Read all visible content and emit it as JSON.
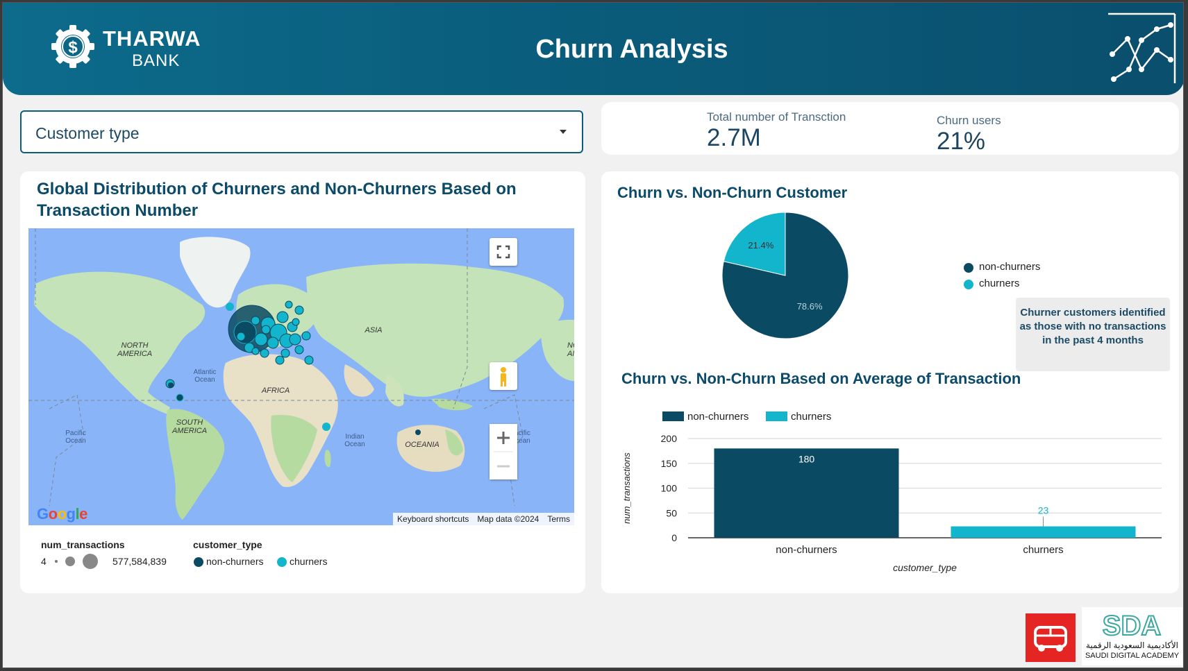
{
  "header": {
    "brand": "THARWA",
    "brand_sub": "BANK",
    "title": "Churn Analysis"
  },
  "filter": {
    "label": "Customer type"
  },
  "kpis": {
    "transactions_label": "Total number of Transction",
    "transactions_value": "2.7M",
    "churn_label": "Churn users",
    "churn_value": "21%"
  },
  "map_card": {
    "title": "Global Distribution of Churners and Non-Churners Based on Transaction Number",
    "labels": {
      "north_america": [
        "NORTH",
        "AMERICA"
      ],
      "south_america": [
        "SOUTH",
        "AMERICA"
      ],
      "africa": "AFRICA",
      "asia": "ASIA",
      "oceania": "OCEANIA",
      "atlantic": [
        "Atlantic",
        "Ocean"
      ],
      "pacific": [
        "Pacific",
        "Ocean"
      ],
      "pacific_right": [
        "Pacific",
        "Ocean"
      ],
      "indian": [
        "Indian",
        "Ocean"
      ],
      "na_right": [
        "NO",
        "AM"
      ]
    },
    "attribution": {
      "shortcuts": "Keyboard shortcuts",
      "map_data": "Map data ©2024",
      "terms": "Terms"
    },
    "google": "Google",
    "legend": {
      "size_title": "num_transactions",
      "size_min": "4",
      "size_max": "577,584,839",
      "color_title": "customer_type",
      "color_items": [
        "non-churners",
        "churners"
      ]
    }
  },
  "colors": {
    "non_churners": "#0b4a63",
    "churners": "#12b5cb",
    "title": "#0b4a69"
  },
  "chart_data": [
    {
      "type": "pie",
      "title": "Churn vs. Non-Churn Customer",
      "categories": [
        "non-churners",
        "churners"
      ],
      "values": [
        78.6,
        21.4
      ],
      "labels": [
        "78.6%",
        "21.4%"
      ],
      "legend": "right"
    },
    {
      "type": "bar",
      "title": "Churn vs. Non-Churn Based on Average of Transaction",
      "categories": [
        "non-churners",
        "churners"
      ],
      "values": [
        180,
        23
      ],
      "xlabel": "customer_type",
      "ylabel": "num_transactions",
      "ylim": [
        0,
        200
      ],
      "yticks": [
        0,
        50,
        100,
        150,
        200
      ],
      "grid": true,
      "legend": "top-left"
    }
  ],
  "note": "Churner customers identified as those with no transactions in the past 4 months",
  "footer": {
    "sda_logo": "SDA",
    "sda_arabic": "الأكاديمية السعودية الرقمية",
    "sda_english": "SAUDI DIGITAL ACADEMY"
  }
}
